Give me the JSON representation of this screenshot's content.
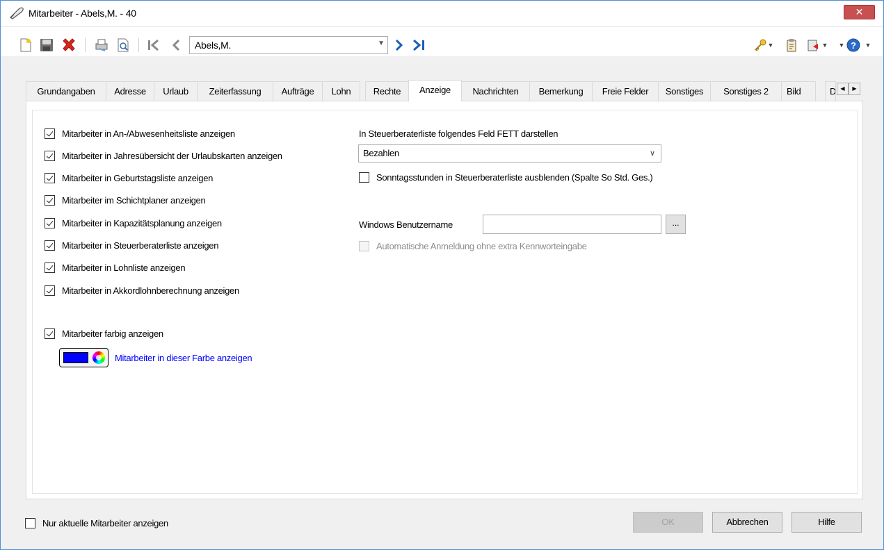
{
  "window": {
    "title": "Mitarbeiter - Abels,M. - 40",
    "close_label": "✕"
  },
  "toolbar": {
    "record_value": "Abels,M."
  },
  "tabs": [
    {
      "label": "Grundangaben"
    },
    {
      "label": "Adresse"
    },
    {
      "label": "Urlaub"
    },
    {
      "label": "Zeiterfassung"
    },
    {
      "label": "Aufträge"
    },
    {
      "label": "Lohn"
    },
    {
      "label": "Rechte"
    },
    {
      "label": "Anzeige",
      "active": true
    },
    {
      "label": "Nachrichten"
    },
    {
      "label": "Bemerkung"
    },
    {
      "label": "Freie Felder"
    },
    {
      "label": "Sonstiges"
    },
    {
      "label": "Sonstiges 2"
    },
    {
      "label": "Bild"
    },
    {
      "label": "D"
    }
  ],
  "display_options": [
    {
      "label": "Mitarbeiter in An-/Abwesenheitsliste anzeigen",
      "checked": true
    },
    {
      "label": "Mitarbeiter in Jahresübersicht der Urlaubskarten anzeigen",
      "checked": true
    },
    {
      "label": "Mitarbeiter in Geburtstagsliste anzeigen",
      "checked": true
    },
    {
      "label": "Mitarbeiter im Schichtplaner anzeigen",
      "checked": true
    },
    {
      "label": "Mitarbeiter in Kapazitätsplanung anzeigen",
      "checked": true
    },
    {
      "label": "Mitarbeiter in Steuerberaterliste anzeigen",
      "checked": true
    },
    {
      "label": "Mitarbeiter in Lohnliste anzeigen",
      "checked": true
    },
    {
      "label": "Mitarbeiter in Akkordlohnberechnung anzeigen",
      "checked": true
    }
  ],
  "color": {
    "checkbox_label": "Mitarbeiter farbig anzeigen",
    "checked": true,
    "color_value": "#0000ff",
    "link_label": "Mitarbeiter in dieser Farbe anzeigen",
    "link_color": "#0000ff"
  },
  "tax_advisor": {
    "bold_field_label": "In Steuerberaterliste folgendes Feld FETT darstellen",
    "bold_field_value": "Bezahlen",
    "hide_sunday_label": "Sonntagsstunden in Steuerberaterliste ausblenden (Spalte So Std. Ges.)",
    "hide_sunday_checked": false
  },
  "windows_login": {
    "username_label": "Windows Benutzername",
    "username_value": "",
    "browse_label": "...",
    "auto_login_label": "Automatische Anmeldung ohne extra Kennworteingabe",
    "auto_login_checked": false,
    "auto_login_disabled": true
  },
  "footer": {
    "only_current_label": "Nur aktuelle Mitarbeiter anzeigen",
    "only_current_checked": false,
    "ok_label": "OK",
    "cancel_label": "Abbrechen",
    "help_label": "Hilfe"
  }
}
